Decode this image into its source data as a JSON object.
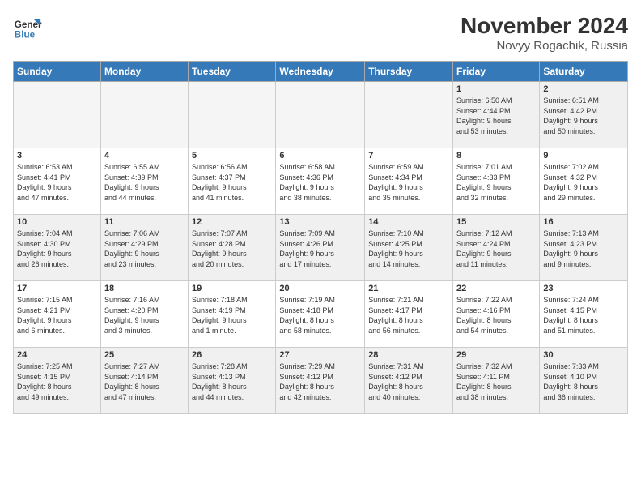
{
  "header": {
    "logo_line1": "General",
    "logo_line2": "Blue",
    "month": "November 2024",
    "location": "Novyy Rogachik, Russia"
  },
  "weekdays": [
    "Sunday",
    "Monday",
    "Tuesday",
    "Wednesday",
    "Thursday",
    "Friday",
    "Saturday"
  ],
  "weeks": [
    [
      {
        "day": "",
        "info": ""
      },
      {
        "day": "",
        "info": ""
      },
      {
        "day": "",
        "info": ""
      },
      {
        "day": "",
        "info": ""
      },
      {
        "day": "",
        "info": ""
      },
      {
        "day": "1",
        "info": "Sunrise: 6:50 AM\nSunset: 4:44 PM\nDaylight: 9 hours\nand 53 minutes."
      },
      {
        "day": "2",
        "info": "Sunrise: 6:51 AM\nSunset: 4:42 PM\nDaylight: 9 hours\nand 50 minutes."
      }
    ],
    [
      {
        "day": "3",
        "info": "Sunrise: 6:53 AM\nSunset: 4:41 PM\nDaylight: 9 hours\nand 47 minutes."
      },
      {
        "day": "4",
        "info": "Sunrise: 6:55 AM\nSunset: 4:39 PM\nDaylight: 9 hours\nand 44 minutes."
      },
      {
        "day": "5",
        "info": "Sunrise: 6:56 AM\nSunset: 4:37 PM\nDaylight: 9 hours\nand 41 minutes."
      },
      {
        "day": "6",
        "info": "Sunrise: 6:58 AM\nSunset: 4:36 PM\nDaylight: 9 hours\nand 38 minutes."
      },
      {
        "day": "7",
        "info": "Sunrise: 6:59 AM\nSunset: 4:34 PM\nDaylight: 9 hours\nand 35 minutes."
      },
      {
        "day": "8",
        "info": "Sunrise: 7:01 AM\nSunset: 4:33 PM\nDaylight: 9 hours\nand 32 minutes."
      },
      {
        "day": "9",
        "info": "Sunrise: 7:02 AM\nSunset: 4:32 PM\nDaylight: 9 hours\nand 29 minutes."
      }
    ],
    [
      {
        "day": "10",
        "info": "Sunrise: 7:04 AM\nSunset: 4:30 PM\nDaylight: 9 hours\nand 26 minutes."
      },
      {
        "day": "11",
        "info": "Sunrise: 7:06 AM\nSunset: 4:29 PM\nDaylight: 9 hours\nand 23 minutes."
      },
      {
        "day": "12",
        "info": "Sunrise: 7:07 AM\nSunset: 4:28 PM\nDaylight: 9 hours\nand 20 minutes."
      },
      {
        "day": "13",
        "info": "Sunrise: 7:09 AM\nSunset: 4:26 PM\nDaylight: 9 hours\nand 17 minutes."
      },
      {
        "day": "14",
        "info": "Sunrise: 7:10 AM\nSunset: 4:25 PM\nDaylight: 9 hours\nand 14 minutes."
      },
      {
        "day": "15",
        "info": "Sunrise: 7:12 AM\nSunset: 4:24 PM\nDaylight: 9 hours\nand 11 minutes."
      },
      {
        "day": "16",
        "info": "Sunrise: 7:13 AM\nSunset: 4:23 PM\nDaylight: 9 hours\nand 9 minutes."
      }
    ],
    [
      {
        "day": "17",
        "info": "Sunrise: 7:15 AM\nSunset: 4:21 PM\nDaylight: 9 hours\nand 6 minutes."
      },
      {
        "day": "18",
        "info": "Sunrise: 7:16 AM\nSunset: 4:20 PM\nDaylight: 9 hours\nand 3 minutes."
      },
      {
        "day": "19",
        "info": "Sunrise: 7:18 AM\nSunset: 4:19 PM\nDaylight: 9 hours\nand 1 minute."
      },
      {
        "day": "20",
        "info": "Sunrise: 7:19 AM\nSunset: 4:18 PM\nDaylight: 8 hours\nand 58 minutes."
      },
      {
        "day": "21",
        "info": "Sunrise: 7:21 AM\nSunset: 4:17 PM\nDaylight: 8 hours\nand 56 minutes."
      },
      {
        "day": "22",
        "info": "Sunrise: 7:22 AM\nSunset: 4:16 PM\nDaylight: 8 hours\nand 54 minutes."
      },
      {
        "day": "23",
        "info": "Sunrise: 7:24 AM\nSunset: 4:15 PM\nDaylight: 8 hours\nand 51 minutes."
      }
    ],
    [
      {
        "day": "24",
        "info": "Sunrise: 7:25 AM\nSunset: 4:15 PM\nDaylight: 8 hours\nand 49 minutes."
      },
      {
        "day": "25",
        "info": "Sunrise: 7:27 AM\nSunset: 4:14 PM\nDaylight: 8 hours\nand 47 minutes."
      },
      {
        "day": "26",
        "info": "Sunrise: 7:28 AM\nSunset: 4:13 PM\nDaylight: 8 hours\nand 44 minutes."
      },
      {
        "day": "27",
        "info": "Sunrise: 7:29 AM\nSunset: 4:12 PM\nDaylight: 8 hours\nand 42 minutes."
      },
      {
        "day": "28",
        "info": "Sunrise: 7:31 AM\nSunset: 4:12 PM\nDaylight: 8 hours\nand 40 minutes."
      },
      {
        "day": "29",
        "info": "Sunrise: 7:32 AM\nSunset: 4:11 PM\nDaylight: 8 hours\nand 38 minutes."
      },
      {
        "day": "30",
        "info": "Sunrise: 7:33 AM\nSunset: 4:10 PM\nDaylight: 8 hours\nand 36 minutes."
      }
    ]
  ]
}
